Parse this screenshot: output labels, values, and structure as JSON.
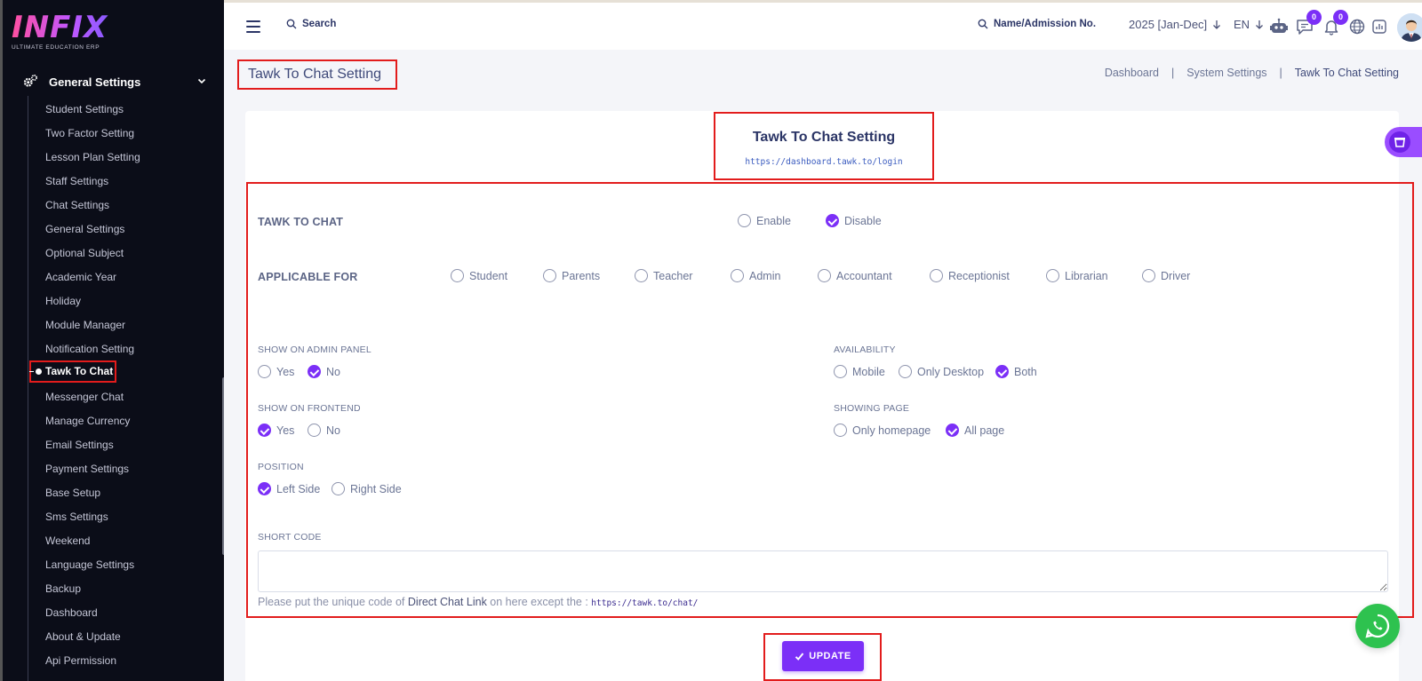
{
  "brand": {
    "logo_text": "INFIX",
    "tagline": "ULTIMATE EDUCATION ERP"
  },
  "sidebar": {
    "section_label": "General Settings",
    "items": [
      "Student Settings",
      "Two Factor Setting",
      "Lesson Plan Setting",
      "Staff Settings",
      "Chat Settings",
      "General Settings",
      "Optional Subject",
      "Academic Year",
      "Holiday",
      "Module Manager",
      "Notification Setting",
      "Tawk To Chat",
      "Messenger Chat",
      "Manage Currency",
      "Email Settings",
      "Payment Settings",
      "Base Setup",
      "Sms Settings",
      "Weekend",
      "Language Settings",
      "Backup",
      "Dashboard",
      "About & Update",
      "Api Permission"
    ],
    "active_item": "Tawk To Chat"
  },
  "topbar": {
    "search_label": "Search",
    "student_search_label": "Name/Admission No.",
    "academic_year": "2025 [Jan-Dec]",
    "language": "EN",
    "chat_count": "0",
    "notification_count": "0"
  },
  "page": {
    "title": "Tawk To Chat Setting",
    "breadcrumb": [
      "Dashboard",
      "System Settings",
      "Tawk To Chat Setting"
    ]
  },
  "card": {
    "title": "Tawk To Chat Setting",
    "link": "https://dashboard.tawk.to/login"
  },
  "form": {
    "tawk_label": "TAWK TO CHAT",
    "tawk_options": [
      {
        "label": "Enable",
        "checked": false
      },
      {
        "label": "Disable",
        "checked": true
      }
    ],
    "applicable_label": "APPLICABLE FOR",
    "applicable_options": [
      "Student",
      "Parents",
      "Teacher",
      "Admin",
      "Accountant",
      "Receptionist",
      "Librarian",
      "Driver"
    ],
    "admin_panel_label": "SHOW ON ADMIN PANEL",
    "admin_panel_options": [
      {
        "label": "Yes",
        "checked": false
      },
      {
        "label": "No",
        "checked": true
      }
    ],
    "availability_label": "AVAILABILITY",
    "availability_options": [
      {
        "label": "Mobile",
        "checked": false
      },
      {
        "label": "Only Desktop",
        "checked": false
      },
      {
        "label": "Both",
        "checked": true
      }
    ],
    "frontend_label": "SHOW ON FRONTEND",
    "frontend_options": [
      {
        "label": "Yes",
        "checked": true
      },
      {
        "label": "No",
        "checked": false
      }
    ],
    "showing_page_label": "SHOWING PAGE",
    "showing_page_options": [
      {
        "label": "Only homepage",
        "checked": false
      },
      {
        "label": "All page",
        "checked": true
      }
    ],
    "position_label": "POSITION",
    "position_options": [
      {
        "label": "Left Side",
        "checked": true
      },
      {
        "label": "Right Side",
        "checked": false
      }
    ],
    "short_code_label": "SHORT CODE",
    "short_code_value": "",
    "hint_prefix": "Please put the unique code of ",
    "hint_bold": "Direct Chat Link",
    "hint_middle": " on here except the : ",
    "hint_url": "https://tawk.to/chat/",
    "update_label": "UPDATE"
  },
  "colors": {
    "accent": "#7b2ff7",
    "highlight_border": "#e21c1c",
    "sidebar_bg": "#0b0d18",
    "whatsapp": "#2ec24f"
  }
}
